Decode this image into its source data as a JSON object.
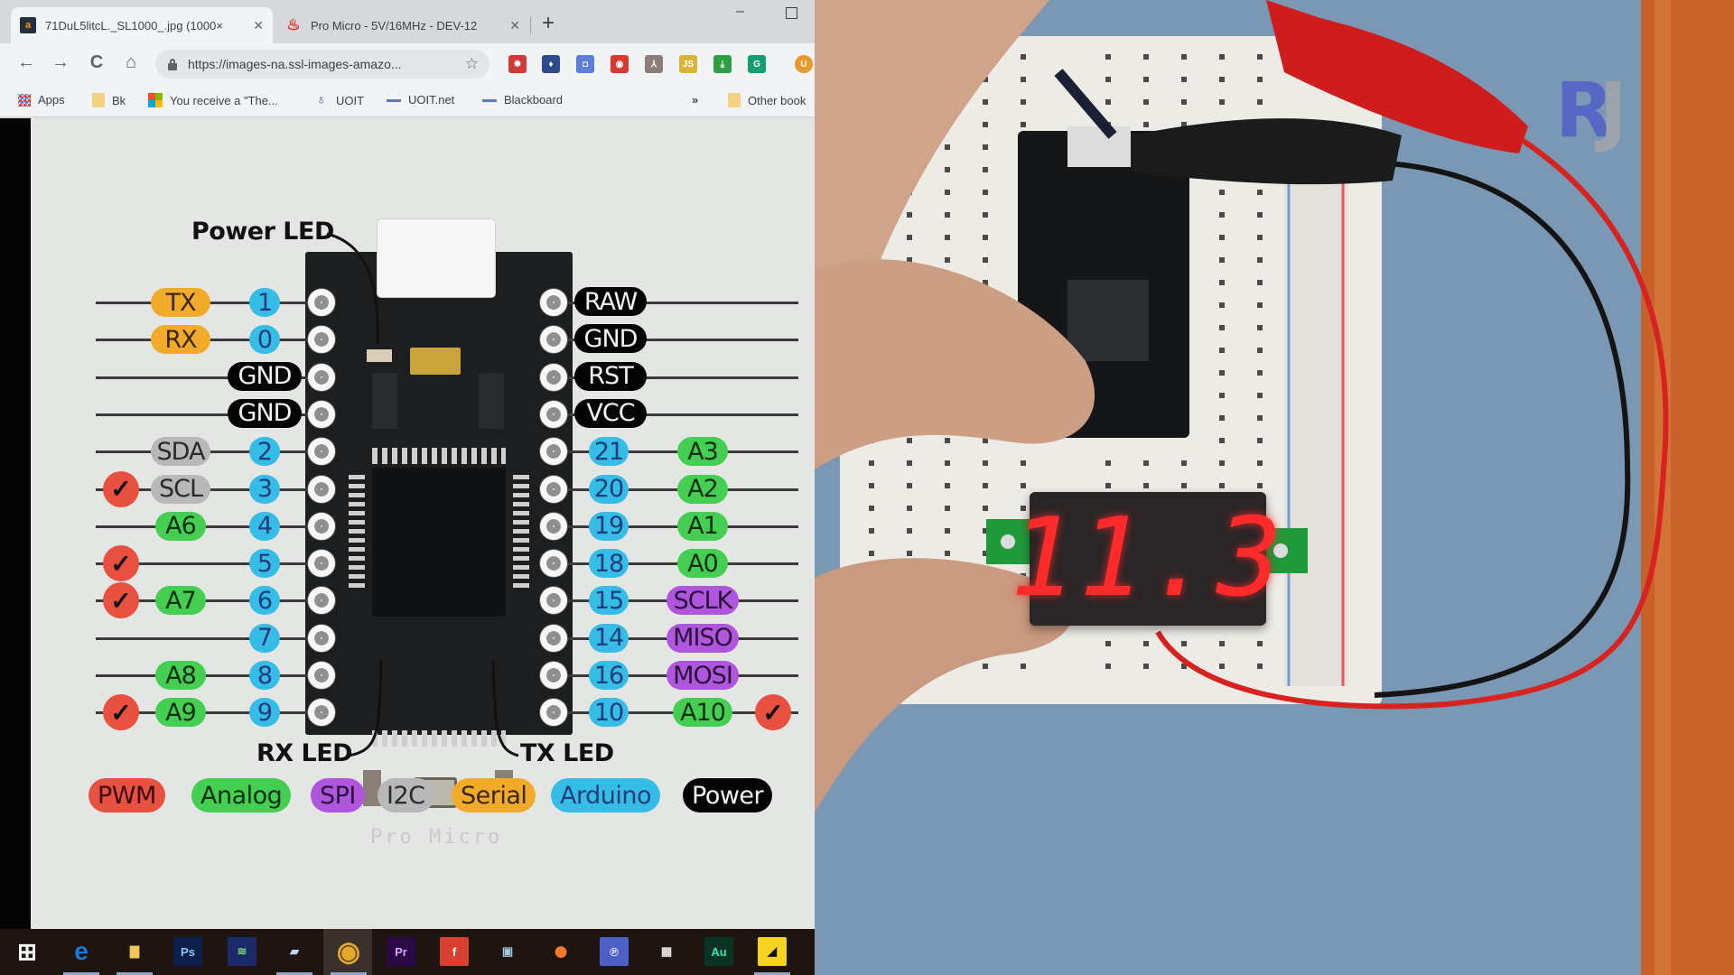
{
  "browser": {
    "tabs": [
      {
        "title": "71DuL5litcL._SL1000_.jpg (1000×",
        "favicon": "amazon-icon",
        "active": true
      },
      {
        "title": "Pro Micro - 5V/16MHz - DEV-12",
        "favicon": "sparkfun-icon",
        "active": false
      }
    ],
    "new_tab_label": "+",
    "window_controls": {
      "minimize": "–",
      "maximize": "□"
    },
    "toolbar": {
      "back": "←",
      "forward": "→",
      "reload": "C",
      "home": "⌂",
      "url": "https://images-na.ssl-images-amazo...",
      "bookmark_star": "☆",
      "extensions": [
        {
          "name": "ext-red-gear-icon",
          "color": "#d23a3a",
          "glyph": "✹"
        },
        {
          "name": "ext-blue-square-icon",
          "color": "#2f4a8a",
          "glyph": "♦"
        },
        {
          "name": "ext-camera-icon",
          "color": "#5b7fd6",
          "glyph": "◘"
        },
        {
          "name": "ext-record-icon",
          "color": "#d83a33",
          "glyph": "◉"
        },
        {
          "name": "ext-pdf-icon",
          "color": "#8c7d78",
          "glyph": "⅄"
        },
        {
          "name": "ext-js-icon",
          "color": "#d9b43a",
          "glyph": "JS"
        },
        {
          "name": "ext-download-icon",
          "color": "#2f9e44",
          "glyph": "⤓"
        },
        {
          "name": "ext-grammarly-icon",
          "color": "#159e6e",
          "glyph": "G"
        },
        {
          "name": "ext-orange-u-icon",
          "color": "#e79a2a",
          "glyph": "U"
        }
      ]
    },
    "bookmarks": [
      {
        "label": "Apps",
        "icon": "apps-grid-icon"
      },
      {
        "label": "Bk",
        "icon": "folder-icon"
      },
      {
        "label": "You receive a \"The...",
        "icon": "microsoft-icon"
      },
      {
        "label": "UOIT",
        "icon": "uoit-shield-icon"
      },
      {
        "label": "UOIT.net",
        "icon": "link-icon"
      },
      {
        "label": "Blackboard",
        "icon": "link-icon"
      }
    ],
    "bookmarks_overflow": "»",
    "other_bookmarks": "Other book"
  },
  "pinout": {
    "callouts": {
      "power_led": "Power LED",
      "rx_led": "RX LED",
      "tx_led": "TX LED"
    },
    "board_silkscreen": "Pro Micro",
    "left_pins": [
      {
        "arduino": "1",
        "func": "TX",
        "func_type": "serial",
        "pwm": false
      },
      {
        "arduino": "0",
        "func": "RX",
        "func_type": "serial",
        "pwm": false
      },
      {
        "power": "GND"
      },
      {
        "power": "GND"
      },
      {
        "arduino": "2",
        "func": "SDA",
        "func_type": "i2c",
        "pwm": false
      },
      {
        "arduino": "3",
        "func": "SCL",
        "func_type": "i2c",
        "pwm": true
      },
      {
        "arduino": "4",
        "func": "A6",
        "func_type": "analog",
        "pwm": false
      },
      {
        "arduino": "5",
        "func": "",
        "func_type": "",
        "pwm": true
      },
      {
        "arduino": "6",
        "func": "A7",
        "func_type": "analog",
        "pwm": true
      },
      {
        "arduino": "7",
        "func": "",
        "func_type": "",
        "pwm": false
      },
      {
        "arduino": "8",
        "func": "A8",
        "func_type": "analog",
        "pwm": false
      },
      {
        "arduino": "9",
        "func": "A9",
        "func_type": "analog",
        "pwm": true
      }
    ],
    "right_pins": [
      {
        "power": "RAW"
      },
      {
        "power": "GND"
      },
      {
        "power": "RST"
      },
      {
        "power": "VCC"
      },
      {
        "arduino": "21",
        "func": "A3",
        "func_type": "analog",
        "pwm": false
      },
      {
        "arduino": "20",
        "func": "A2",
        "func_type": "analog",
        "pwm": false
      },
      {
        "arduino": "19",
        "func": "A1",
        "func_type": "analog",
        "pwm": false
      },
      {
        "arduino": "18",
        "func": "A0",
        "func_type": "analog",
        "pwm": false
      },
      {
        "arduino": "15",
        "func": "SCLK",
        "func_type": "spi",
        "pwm": false
      },
      {
        "arduino": "14",
        "func": "MISO",
        "func_type": "spi",
        "pwm": false
      },
      {
        "arduino": "16",
        "func": "MOSI",
        "func_type": "spi",
        "pwm": false
      },
      {
        "arduino": "10",
        "func": "A10",
        "func_type": "analog",
        "pwm": true
      }
    ],
    "check_glyph": "✓",
    "legend": [
      {
        "label": "PWM",
        "bg": "#e8503f",
        "fg": "#3a0d08"
      },
      {
        "label": "Analog",
        "bg": "#45cf52",
        "fg": "#0d2e10"
      },
      {
        "label": "SPI",
        "bg": "#b056dd",
        "fg": "#28103a"
      },
      {
        "label": "I2C",
        "bg": "#b8b8b8",
        "fg": "#2a2a2a"
      },
      {
        "label": "Serial",
        "bg": "#f2aa2a",
        "fg": "#3a2608"
      },
      {
        "label": "Arduino",
        "bg": "#35bde8",
        "fg": "#1f3d7a"
      },
      {
        "label": "Power",
        "bg": "#050505",
        "fg": "#f2f2f2"
      }
    ]
  },
  "taskbar": {
    "items": [
      {
        "name": "windows-start-icon",
        "glyph": "⊞",
        "color": "#ffffff",
        "bg": "transparent"
      },
      {
        "name": "edge-icon",
        "glyph": "e",
        "color": "#1e78d7",
        "bg": "transparent"
      },
      {
        "name": "file-explorer-icon",
        "glyph": "▇",
        "color": "#f1c75a",
        "bg": "transparent"
      },
      {
        "name": "photoshop-icon",
        "glyph": "Ps",
        "color": "#8ec5ff",
        "bg": "#0c1f4a"
      },
      {
        "name": "app-stripes-icon",
        "glyph": "≋",
        "color": "#7ad36b",
        "bg": "#1c2a6a"
      },
      {
        "name": "notepad-icon",
        "glyph": "▰",
        "color": "#b9d8ef",
        "bg": "transparent"
      },
      {
        "name": "chrome-icon",
        "glyph": "◉",
        "color": "#e4a82a",
        "bg": "transparent"
      },
      {
        "name": "premiere-icon",
        "glyph": "Pr",
        "color": "#d8a3ff",
        "bg": "#2a0a45"
      },
      {
        "name": "foxit-icon",
        "glyph": "f",
        "color": "#ffffff",
        "bg": "#d8412f"
      },
      {
        "name": "photos-app-icon",
        "glyph": "▣",
        "color": "#9fc5e0",
        "bg": "transparent"
      },
      {
        "name": "firefox-icon",
        "glyph": "●",
        "color": "#f2792c",
        "bg": "transparent"
      },
      {
        "name": "app-p-icon",
        "glyph": "℗",
        "color": "#ffffff",
        "bg": "#4c5fc4"
      },
      {
        "name": "calculator-icon",
        "glyph": "▦",
        "color": "#e8e8e8",
        "bg": "transparent"
      },
      {
        "name": "audition-icon",
        "glyph": "Au",
        "color": "#3ee6a6",
        "bg": "#0a3326"
      },
      {
        "name": "sticky-notes-icon",
        "glyph": "◢",
        "color": "#111111",
        "bg": "#f5d320"
      }
    ]
  },
  "camera": {
    "voltmeter_reading": "11.3",
    "logo": {
      "left": "R",
      "right": "J"
    }
  }
}
